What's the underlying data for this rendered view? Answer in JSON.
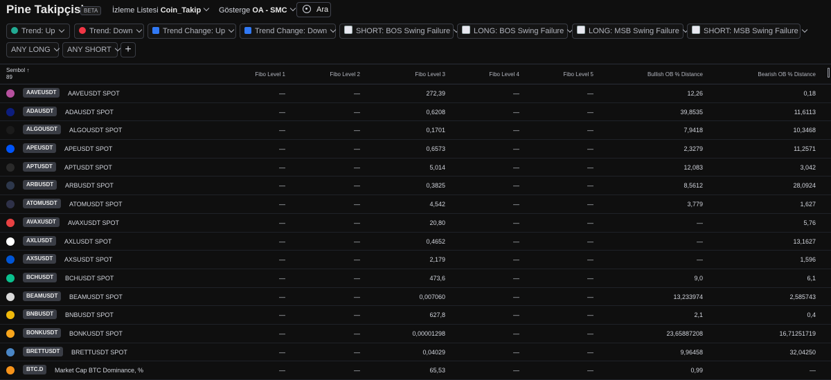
{
  "header": {
    "title": "Pine Takipçisi",
    "badge": "BETA",
    "watchlist_label": "İzleme Listesi",
    "watchlist_value": "Coin_Takip",
    "indicator_label": "Gösterge",
    "indicator_value": "OA - SMC",
    "search_label": "Ara"
  },
  "filters": [
    {
      "label": "Trend: Up",
      "icon": "green-dot",
      "color": "#22ab94"
    },
    {
      "label": "Trend: Down",
      "icon": "red-dot",
      "color": "#f23645"
    },
    {
      "label": "Trend Change: Up",
      "icon": "refresh-square",
      "color": "#3179f5"
    },
    {
      "label": "Trend Change: Down",
      "icon": "refresh-square",
      "color": "#3179f5"
    },
    {
      "label": "SHORT: BOS Swing Failure",
      "icon": "chart-square",
      "color": "#e8e8f0"
    },
    {
      "label": "LONG: BOS Swing Failure",
      "icon": "chart-square",
      "color": "#e8e8f0"
    },
    {
      "label": "LONG: MSB Swing Failure",
      "icon": "chart-square",
      "color": "#e8e8f0"
    },
    {
      "label": "SHORT: MSB Swing Failure",
      "icon": "chart-square",
      "color": "#e8e8f0"
    },
    {
      "label": "ANY LONG"
    },
    {
      "label": "ANY SHORT"
    }
  ],
  "table": {
    "symbol_header": "Sembol",
    "symbol_count": "89",
    "columns": [
      "Fibo Level 1",
      "Fibo Level 2",
      "Fibo Level 3",
      "Fibo Level 4",
      "Fibo Level 5",
      "Bullish OB % Distance",
      "Bearish OB % Distance"
    ],
    "rows": [
      {
        "ticker": "AAVEUSDT",
        "desc": "AAVEUSDT SPOT",
        "logo": "#b6509e",
        "v": [
          "—",
          "—",
          "272,39",
          "—",
          "—",
          "12,26",
          "0,18"
        ]
      },
      {
        "ticker": "ADAUSDT",
        "desc": "ADAUSDT SPOT",
        "logo": "#0d1e7e",
        "v": [
          "—",
          "—",
          "0,6208",
          "—",
          "—",
          "39,8535",
          "11,6113"
        ]
      },
      {
        "ticker": "ALGOUSDT",
        "desc": "ALGOUSDT SPOT",
        "logo": "#1b1b1b",
        "v": [
          "—",
          "—",
          "0,1701",
          "—",
          "—",
          "7,9418",
          "10,3468"
        ]
      },
      {
        "ticker": "APEUSDT",
        "desc": "APEUSDT SPOT",
        "logo": "#0054f9",
        "v": [
          "—",
          "—",
          "0,6573",
          "—",
          "—",
          "2,3279",
          "11,2571"
        ]
      },
      {
        "ticker": "APTUSDT",
        "desc": "APTUSDT SPOT",
        "logo": "#2a2a2a",
        "v": [
          "—",
          "—",
          "5,014",
          "—",
          "—",
          "12,083",
          "3,042"
        ]
      },
      {
        "ticker": "ARBUSDT",
        "desc": "ARBUSDT SPOT",
        "logo": "#2d374b",
        "v": [
          "—",
          "—",
          "0,3825",
          "—",
          "—",
          "8,5612",
          "28,0924"
        ]
      },
      {
        "ticker": "ATOMUSDT",
        "desc": "ATOMUSDT SPOT",
        "logo": "#2e3148",
        "v": [
          "—",
          "—",
          "4,542",
          "—",
          "—",
          "3,779",
          "1,627"
        ]
      },
      {
        "ticker": "AVAXUSDT",
        "desc": "AVAXUSDT SPOT",
        "logo": "#e84142",
        "v": [
          "—",
          "—",
          "20,80",
          "—",
          "—",
          "—",
          "5,76"
        ]
      },
      {
        "ticker": "AXLUSDT",
        "desc": "AXLUSDT SPOT",
        "logo": "#ffffff",
        "v": [
          "—",
          "—",
          "0,4652",
          "—",
          "—",
          "—",
          "13,1627"
        ]
      },
      {
        "ticker": "AXSUSDT",
        "desc": "AXSUSDT SPOT",
        "logo": "#0055d5",
        "v": [
          "—",
          "—",
          "2,179",
          "—",
          "—",
          "—",
          "1,596"
        ]
      },
      {
        "ticker": "BCHUSDT",
        "desc": "BCHUSDT SPOT",
        "logo": "#0ac18e",
        "v": [
          "—",
          "—",
          "473,6",
          "—",
          "—",
          "9,0",
          "6,1"
        ]
      },
      {
        "ticker": "BEAMUSDT",
        "desc": "BEAMUSDT SPOT",
        "logo": "#d9d9d9",
        "v": [
          "—",
          "—",
          "0,007060",
          "—",
          "—",
          "13,233974",
          "2,585743"
        ]
      },
      {
        "ticker": "BNBUSDT",
        "desc": "BNBUSDT SPOT",
        "logo": "#f0b90b",
        "v": [
          "—",
          "—",
          "627,8",
          "—",
          "—",
          "2,1",
          "0,4"
        ]
      },
      {
        "ticker": "BONKUSDT",
        "desc": "BONKUSDT SPOT",
        "logo": "#f8a51c",
        "v": [
          "—",
          "—",
          "0,00001298",
          "—",
          "—",
          "23,65887208",
          "16,71251719"
        ]
      },
      {
        "ticker": "BRETTUSDT",
        "desc": "BRETTUSDT SPOT",
        "logo": "#4a86c5",
        "v": [
          "—",
          "—",
          "0,04029",
          "—",
          "—",
          "9,96458",
          "32,04250"
        ]
      },
      {
        "ticker": "BTC.D",
        "desc": "Market Cap BTC Dominance, %",
        "logo": "#f7931a",
        "v": [
          "—",
          "—",
          "65,53",
          "—",
          "—",
          "0,99",
          "—"
        ]
      }
    ]
  }
}
